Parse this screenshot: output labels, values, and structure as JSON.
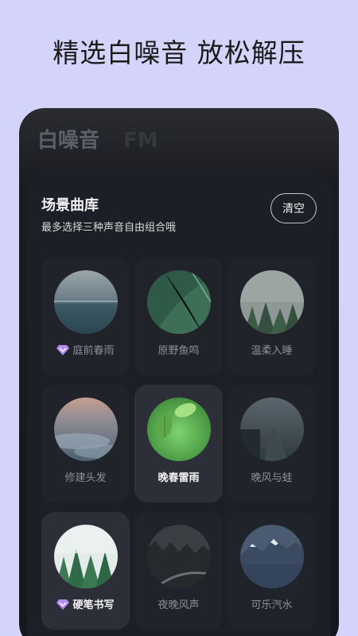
{
  "headline": "精选白噪音  放松解压",
  "tabs": [
    {
      "label": "白噪音",
      "active": true
    },
    {
      "label": "FM",
      "active": false
    }
  ],
  "library": {
    "title": "场景曲库",
    "subtitle": "最多选择三种声音自由组合哦",
    "clear_label": "清空"
  },
  "sounds": [
    {
      "label": "庭前春雨",
      "vip": true,
      "selected": false,
      "icon": "rain-lake-image"
    },
    {
      "label": "原野鱼鸣",
      "vip": false,
      "selected": false,
      "icon": "leaf-image"
    },
    {
      "label": "温柔入睡",
      "vip": false,
      "selected": false,
      "icon": "misty-forest-image"
    },
    {
      "label": "修建头发",
      "vip": false,
      "selected": false,
      "icon": "clouds-image"
    },
    {
      "label": "晚春雷雨",
      "vip": false,
      "selected": true,
      "icon": "green-leaves-image"
    },
    {
      "label": "晚风与蛙",
      "vip": false,
      "selected": false,
      "icon": "foggy-road-image"
    },
    {
      "label": "硬笔书写",
      "vip": true,
      "selected": true,
      "icon": "pine-forest-image"
    },
    {
      "label": "夜晚风声",
      "vip": false,
      "selected": false,
      "icon": "night-road-image"
    },
    {
      "label": "可乐汽水",
      "vip": false,
      "selected": false,
      "icon": "mountain-image"
    }
  ],
  "colors": {
    "page_bg": "#d4d3fa",
    "panel_bg": "#1c1f25",
    "vip_accent": "#b48cf5"
  }
}
